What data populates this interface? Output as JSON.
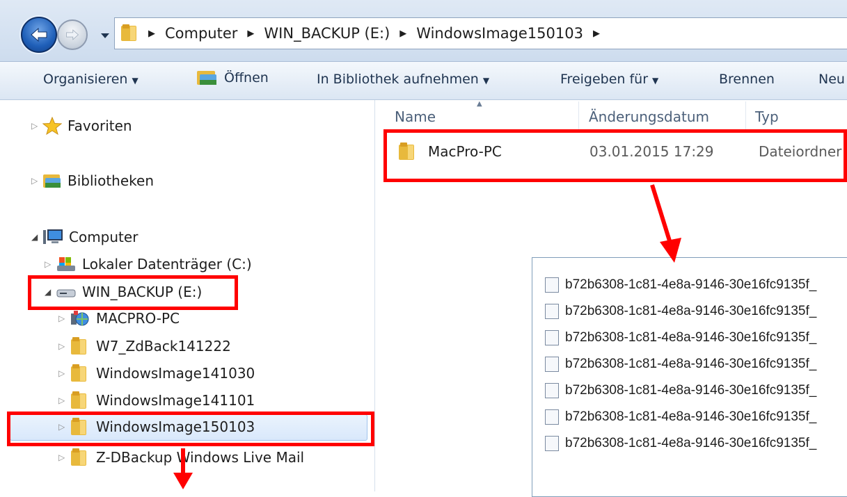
{
  "address": {
    "breadcrumb": [
      "Computer",
      "WIN_BACKUP (E:)",
      "WindowsImage150103"
    ]
  },
  "toolbar": {
    "organize": "Organisieren",
    "open": "Öffnen",
    "add_to_library": "In Bibliothek aufnehmen",
    "share_with": "Freigeben für",
    "burn": "Brennen",
    "new_folder_partial": "Neu"
  },
  "nav": {
    "favorites": "Favoriten",
    "libraries": "Bibliotheken",
    "computer": "Computer",
    "drives": [
      {
        "label": "Lokaler Datenträger (C:)",
        "icon": "hard-drive-icon"
      },
      {
        "label": "WIN_BACKUP (E:)",
        "icon": "external-drive-icon"
      }
    ],
    "backup_children": [
      {
        "label": "MACPRO-PC",
        "icon": "network-pc-icon"
      },
      {
        "label": "W7_ZdBack141222",
        "icon": "folder-icon"
      },
      {
        "label": "WindowsImage141030",
        "icon": "folder-icon"
      },
      {
        "label": "WindowsImage141101",
        "icon": "folder-icon"
      },
      {
        "label": "WindowsImage150103",
        "icon": "folder-icon"
      },
      {
        "label": "Z-DBackup Windows Live Mail",
        "icon": "folder-icon"
      }
    ]
  },
  "content": {
    "columns": [
      "Name",
      "Änderungsdatum",
      "Typ"
    ],
    "rows": [
      {
        "name": "MacPro-PC",
        "date": "03.01.2015 17:29",
        "type": "Dateiordner"
      }
    ]
  },
  "inset": {
    "files": [
      "b72b6308-1c81-4e8a-9146-30e16fc9135f_",
      "b72b6308-1c81-4e8a-9146-30e16fc9135f_",
      "b72b6308-1c81-4e8a-9146-30e16fc9135f_",
      "b72b6308-1c81-4e8a-9146-30e16fc9135f_",
      "b72b6308-1c81-4e8a-9146-30e16fc9135f_",
      "b72b6308-1c81-4e8a-9146-30e16fc9135f_",
      "b72b6308-1c81-4e8a-9146-30e16fc9135f_"
    ]
  },
  "colors": {
    "annotation": "#ff0000",
    "selection": "#d9e8fb",
    "folder": "#e8b93c"
  }
}
